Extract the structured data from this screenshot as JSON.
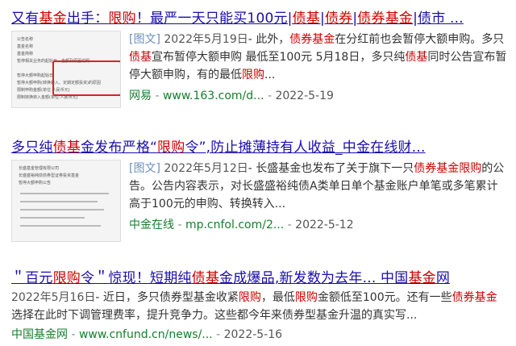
{
  "results": [
    {
      "title_parts": [
        "又有",
        "基金",
        "出手：",
        "限购",
        "！最严一天只能买100元|",
        "债基",
        "|",
        "债券",
        "|",
        "债券基金",
        "|债市 ..."
      ],
      "title_hl": [
        false,
        true,
        false,
        true,
        false,
        true,
        false,
        true,
        false,
        true,
        false
      ],
      "tag": "[图文]",
      "date": "2022年5月19日",
      "snippet_parts": [
        "- 此外，",
        "债券基金",
        "在分红前也会暂停大额申购。",
        "多只",
        "债基",
        "宣布暂停大额申购 最低至100元 5月18日，多只纯",
        "债基",
        "同时公告宣布暂停大额申购，有的最低",
        "限购",
        "..."
      ],
      "snippet_hl": [
        false,
        true,
        false,
        false,
        true,
        false,
        true,
        false,
        true,
        false
      ],
      "source": "网易",
      "url": "www.163.com/d...",
      "time": "2022-5-19"
    },
    {
      "title_parts": [
        "多只纯",
        "债基",
        "金发布严格“",
        "限购",
        "令”,防止摊薄持有人收益_中金在线财..."
      ],
      "title_hl": [
        false,
        true,
        false,
        true,
        false
      ],
      "tag": "[图文]",
      "date": "2022年5月12日",
      "snippet_parts": [
        "- 长盛基金也发布了关于旗下一只",
        "债券基金",
        "限购",
        "的公告。公告内容表示，对长盛盛裕纯债A类单日单个基金账户单笔或多笔累计高于100元的申购、转换转入..."
      ],
      "snippet_hl": [
        false,
        true,
        true,
        false
      ],
      "source": "中金在线",
      "url": "mp.cnfol.com/2...",
      "time": "2022-5-12"
    },
    {
      "title_parts": [
        "＂百元",
        "限购",
        "令＂惊现！短期纯",
        "债基",
        "金成爆品,新发数为去年... 中国",
        "基金",
        "网"
      ],
      "title_hl": [
        false,
        true,
        false,
        true,
        false,
        true,
        false
      ],
      "date": "2022年5月16日",
      "snippet_parts": [
        "- 近日，多只债券型基金收紧",
        "限购",
        "，最低",
        "限购",
        "金额低至100元。还有一些",
        "债券基金",
        "选择在此时下调管理费率，提升竞争力。这些都今年来债券型基金升温的真实写..."
      ],
      "snippet_hl": [
        false,
        true,
        false,
        true,
        false,
        true,
        false
      ],
      "source": "中国基金网",
      "url": "www.cnfund.cn/news/...",
      "time": "2022-5-16"
    }
  ],
  "thumb1_lines": [
    "公告名称",
    "基金名称",
    "基金简称",
    "暂停相关业务的起始日、金额及原因说明",
    "",
    "暂停大额申购起始日",
    "暂停大额申购(转换转入、定期定额投资)的原因",
    "限制申购金额(单位:人民币元)",
    "限制转换转入金额(单位:人民币元)"
  ],
  "thumb2_lines": [
    "长盛基金管理有限公司",
    "长盛盛裕纯债债券型证券投资基金",
    "暂停大额申购公告"
  ],
  "colors": {
    "link": "#1a0dab",
    "highlight": "#cc0000",
    "source": "#167e2d",
    "tag": "#6a8fc0"
  }
}
